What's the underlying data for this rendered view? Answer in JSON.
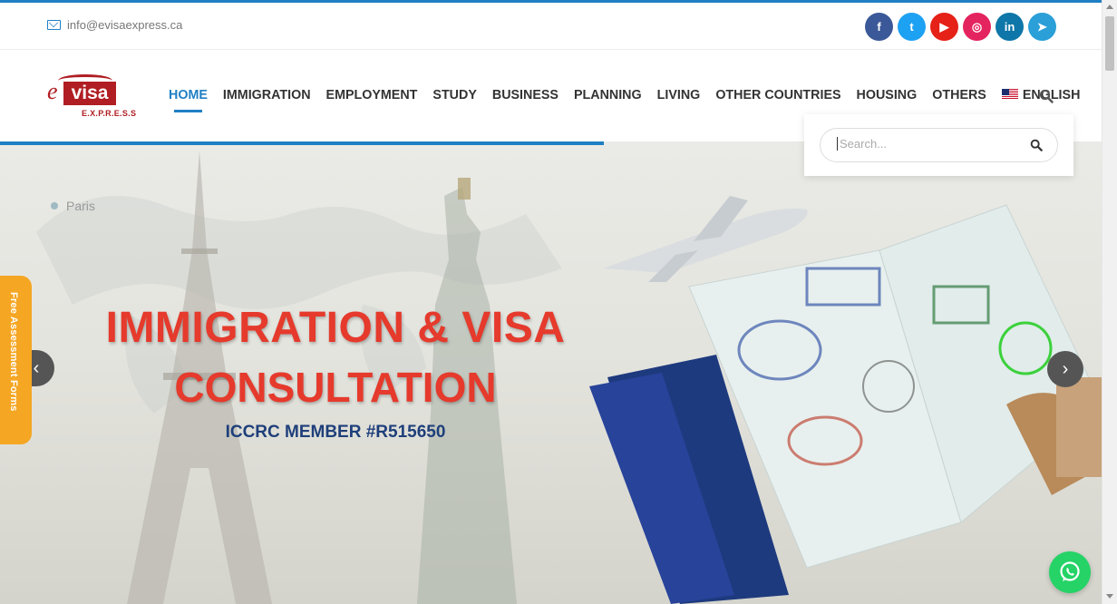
{
  "topbar": {
    "email": "info@evisaexpress.ca",
    "socials": [
      {
        "icon": "facebook-icon",
        "glyph": "f",
        "color": "#3b5998"
      },
      {
        "icon": "twitter-icon",
        "glyph": "t",
        "color": "#1da1f2"
      },
      {
        "icon": "youtube-icon",
        "glyph": "▶",
        "color": "#e62117"
      },
      {
        "icon": "instagram-icon",
        "glyph": "◎",
        "color": "#e4245f"
      },
      {
        "icon": "linkedin-icon",
        "glyph": "in",
        "color": "#0e76a8"
      },
      {
        "icon": "telegram-icon",
        "glyph": "➤",
        "color": "#2a9fd8"
      }
    ]
  },
  "logo": {
    "prefix": "e",
    "main": "visa",
    "sub": "E.X.P.R.E.S.S"
  },
  "nav": {
    "items": [
      "HOME",
      "IMMIGRATION",
      "EMPLOYMENT",
      "STUDY",
      "BUSINESS",
      "PLANNING",
      "LIVING",
      "OTHER COUNTRIES",
      "HOUSING",
      "OTHERS"
    ],
    "active": "HOME",
    "language": "ENGLISH"
  },
  "search": {
    "placeholder": "Search..."
  },
  "hero": {
    "map_label": "Paris",
    "headline_1": "IMMIGRATION & VISA",
    "headline_2": "CONSULTATION",
    "subheadline": "ICCRC MEMBER #R515650",
    "prev_arrow": "‹",
    "next_arrow": "›"
  },
  "side_tab": {
    "label": "Free Assessment Forms"
  },
  "colors": {
    "accent": "#1f7fc4",
    "headline": "#e53a2c",
    "member": "#1e3f7a",
    "tab": "#f5a623",
    "whatsapp": "#25d366"
  }
}
